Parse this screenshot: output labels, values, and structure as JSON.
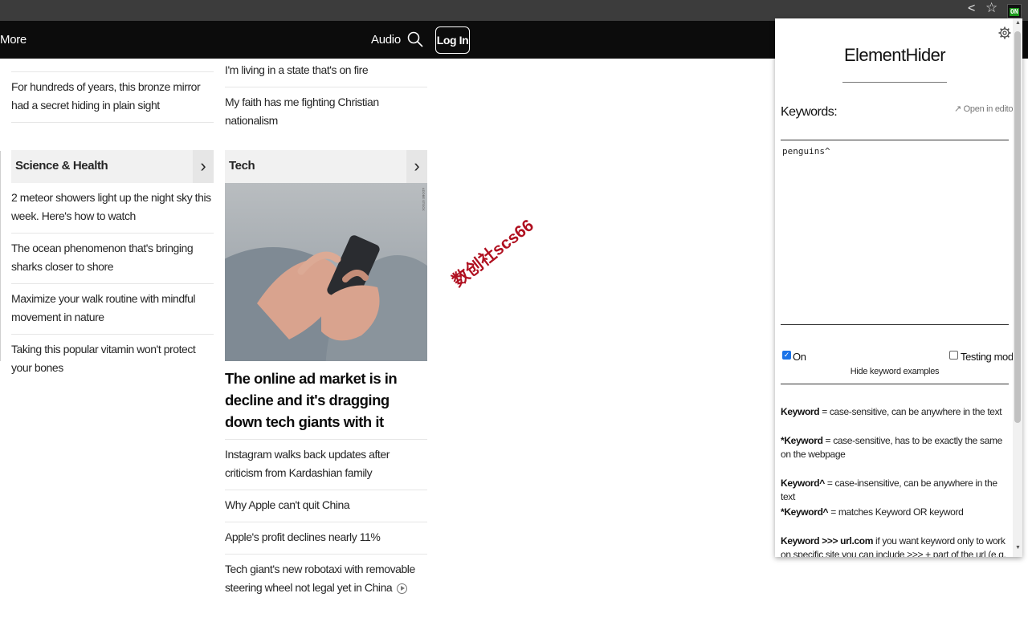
{
  "browser": {
    "share_icon": "share-icon",
    "star_icon": "star-icon",
    "extension_badge": "ON"
  },
  "header": {
    "more_label": "More",
    "audio_label": "Audio",
    "search_icon": "search-icon",
    "login_label": "Log In"
  },
  "left_column": {
    "top_headlines": [
      "For hundreds of years, this bronze mirror had a secret hiding in plain sight"
    ],
    "section": {
      "title": "Science & Health",
      "arrow": "›",
      "headlines": [
        "2 meteor showers light up the night sky this week. Here's how to watch",
        "The ocean phenomenon that's bringing sharks closer to shore",
        "Maximize your walk routine with mindful movement in nature",
        "Taking this popular vitamin won't protect your bones"
      ]
    }
  },
  "middle_column": {
    "top_headlines": [
      "I'm living in a state that's on fire",
      "My faith has me fighting Christian nationalism"
    ],
    "section": {
      "title": "Tech",
      "arrow": "›",
      "hero_credit": "ADOBE STOCK",
      "lead_headline": "The online ad market is in decline and it's dragging down tech giants with it",
      "headlines": [
        "Instagram walks back updates after criticism from Kardashian family",
        "Why Apple can't quit China",
        "Apple's profit declines nearly 11%",
        "Tech giant's new robotaxi with removable steering wheel not legal yet in China"
      ]
    }
  },
  "watermark": "数创社scs66",
  "popup": {
    "title": "ElementHider",
    "keywords_label": "Keywords:",
    "open_editor": "↗ Open in editor",
    "keywords_value": "penguins^",
    "on_label": "On",
    "on_checked": true,
    "testing_label": "Testing mode",
    "testing_checked": false,
    "hide_examples": "Hide keyword examples",
    "help": [
      {
        "key": "Keyword",
        "desc": " = case-sensitive, can be anywhere in the text"
      },
      {
        "key": "*Keyword",
        "desc": " = case-sensitive, has to be exactly the same on the webpage"
      },
      {
        "key": "Keyword^",
        "desc": " = case-insensitive, can be anywhere in the text"
      },
      {
        "key": "*Keyword^",
        "desc": " = matches Keyword OR keyword"
      },
      {
        "key": "Keyword >>> url.com",
        "desc": " if you want keyword only to work on specific site you can include >>> + part of the url (e.g. \"keyword"
      }
    ]
  }
}
